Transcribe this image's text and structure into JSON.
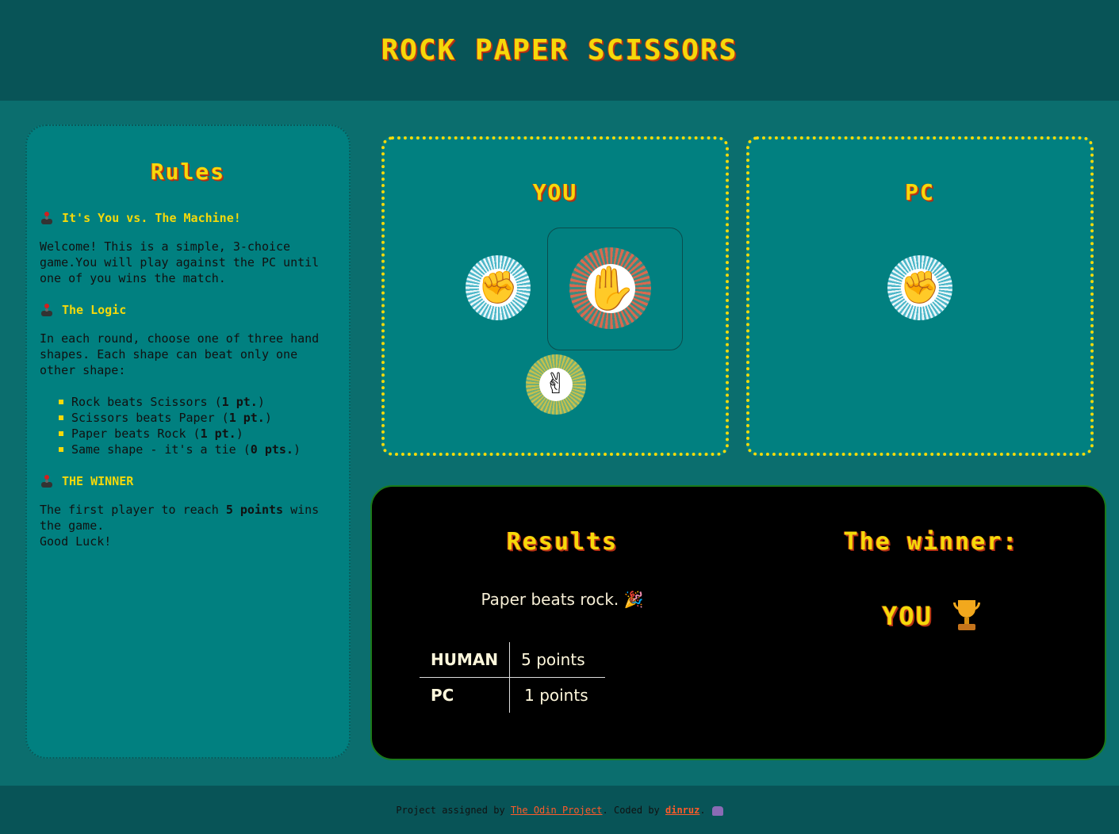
{
  "header": {
    "title": "ROCK PAPER SCISSORS"
  },
  "rules": {
    "title": "Rules",
    "section1": {
      "heading": "It's You vs. The Machine!",
      "text": "Welcome! This is a simple, 3-choice game.You will play against the PC until one of you wins the match."
    },
    "section2": {
      "heading": "The Logic",
      "text": "In each round, choose one of three hand shapes. Each shape can beat only one other shape:",
      "items": [
        {
          "text": "Rock beats Scissors (",
          "bold": "1 pt.",
          "end": ")"
        },
        {
          "text": "Scissors beats Paper (",
          "bold": "1 pt.",
          "end": ")"
        },
        {
          "text": "Paper beats Rock (",
          "bold": "1 pt.",
          "end": ")"
        },
        {
          "text": "Same shape - it's a tie (",
          "bold": "0 pts.",
          "end": ")"
        }
      ]
    },
    "section3": {
      "heading": "THE WINNER",
      "text_before": "The first player to reach ",
      "text_bold": "5 points",
      "text_after": " wins the game.",
      "text_last": "Good Luck!"
    }
  },
  "player": {
    "title": "YOU",
    "choices": [
      {
        "name": "rock",
        "icon": "rock-hand-icon",
        "glyph": "✊"
      },
      {
        "name": "paper",
        "icon": "paper-hand-icon",
        "glyph": "✋",
        "selected": true
      },
      {
        "name": "scissors",
        "icon": "scissors-hand-icon",
        "glyph": "✌"
      }
    ]
  },
  "pc": {
    "title": "PC",
    "choice": {
      "name": "rock",
      "icon": "rock-hand-icon",
      "glyph": "✊"
    }
  },
  "results": {
    "title": "Results",
    "round_message": "Paper beats rock. 🎉",
    "scores": [
      {
        "name": "HUMAN",
        "points": "5 points"
      },
      {
        "name": "PC",
        "points": "1 points"
      }
    ]
  },
  "winner": {
    "title": "The winner:",
    "name": "YOU",
    "icon": "trophy-icon"
  },
  "footer": {
    "prefix": "Project assigned by ",
    "link1": "The Odin Project",
    "middle": ". Coded by ",
    "link2": "dinruz",
    "suffix": ".",
    "icon": "alien-icon"
  },
  "colors": {
    "background": "#0b6e6e",
    "header": "#085457",
    "accent": "#f5d90a",
    "link": "#ff5b29",
    "results_bg": "#000000"
  }
}
